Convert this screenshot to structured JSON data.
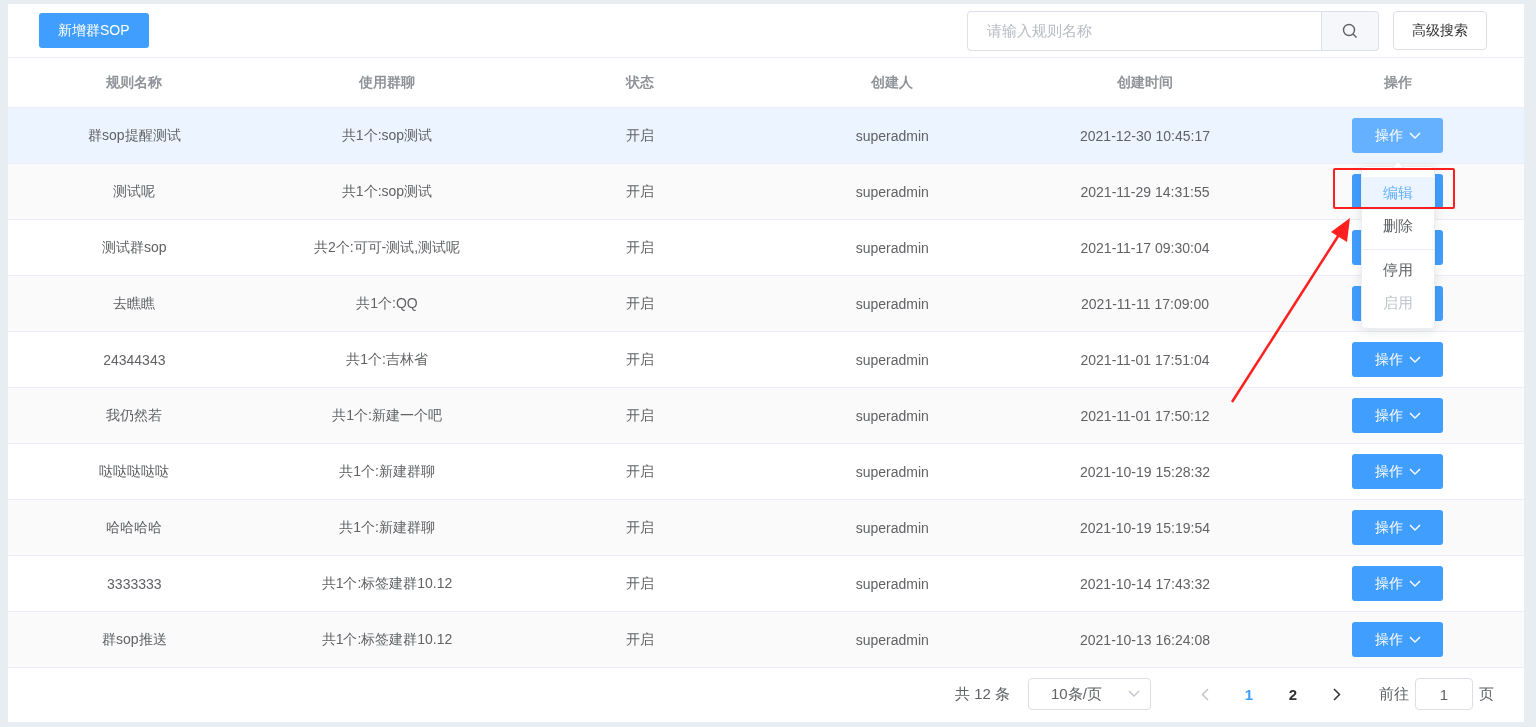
{
  "toolbar": {
    "add_button": "新增群SOP",
    "search": {
      "placeholder": "请输入规则名称"
    },
    "advanced_button": "高级搜索"
  },
  "table": {
    "columns": [
      "规则名称",
      "使用群聊",
      "状态",
      "创建人",
      "创建时间",
      "操作"
    ],
    "rows": [
      {
        "name": "群sop提醒测试",
        "groups": "共1个:sop测试",
        "status": "开启",
        "creator": "superadmin",
        "created": "2021-12-30 10:45:17",
        "action": "操作",
        "hovered": true
      },
      {
        "name": "测试呢",
        "groups": "共1个:sop测试",
        "status": "开启",
        "creator": "superadmin",
        "created": "2021-11-29 14:31:55",
        "hovered": false
      },
      {
        "name": "测试群sop",
        "groups": "共2个:可可-测试,测试呢",
        "status": "开启",
        "creator": "superadmin",
        "created": "2021-11-17 09:30:04",
        "hovered": false
      },
      {
        "name": "去瞧瞧",
        "groups": "共1个:QQ",
        "status": "开启",
        "creator": "superadmin",
        "created": "2021-11-11 17:09:00",
        "hovered": false
      },
      {
        "name": "24344343",
        "groups": "共1个:吉林省",
        "status": "开启",
        "creator": "superadmin",
        "created": "2021-11-01 17:51:04",
        "action": "操作",
        "hovered": false
      },
      {
        "name": "我仍然若",
        "groups": "共1个:新建一个吧",
        "status": "开启",
        "creator": "superadmin",
        "created": "2021-11-01 17:50:12",
        "action": "操作",
        "hovered": false
      },
      {
        "name": "哒哒哒哒哒",
        "groups": "共1个:新建群聊",
        "status": "开启",
        "creator": "superadmin",
        "created": "2021-10-19 15:28:32",
        "action": "操作",
        "hovered": false
      },
      {
        "name": "哈哈哈哈",
        "groups": "共1个:新建群聊",
        "status": "开启",
        "creator": "superadmin",
        "created": "2021-10-19 15:19:54",
        "action": "操作",
        "hovered": false
      },
      {
        "name": "3333333",
        "groups": "共1个:标签建群10.12",
        "status": "开启",
        "creator": "superadmin",
        "created": "2021-10-14 17:43:32",
        "action": "操作",
        "hovered": false
      },
      {
        "name": "群sop推送",
        "groups": "共1个:标签建群10.12",
        "status": "开启",
        "creator": "superadmin",
        "created": "2021-10-13 16:24:08",
        "action": "操作",
        "hovered": false
      }
    ]
  },
  "action_menu": {
    "items": [
      {
        "label": "编辑",
        "selected": true,
        "disabled": false,
        "divided": false
      },
      {
        "label": "删除",
        "selected": false,
        "disabled": false,
        "divided": false
      },
      {
        "label": "停用",
        "selected": false,
        "disabled": false,
        "divided": true
      },
      {
        "label": "启用",
        "selected": false,
        "disabled": true,
        "divided": false
      }
    ]
  },
  "annotations": {
    "highlight_box": true,
    "pointer_arrow": true
  },
  "pagination": {
    "total": "共 12 条",
    "page_size": "10条/页",
    "pages": [
      {
        "label": "1",
        "selected": true
      },
      {
        "label": "2",
        "selected": false
      }
    ],
    "goto_label": "前往",
    "goto_value": "1",
    "goto_suffix": "页"
  }
}
